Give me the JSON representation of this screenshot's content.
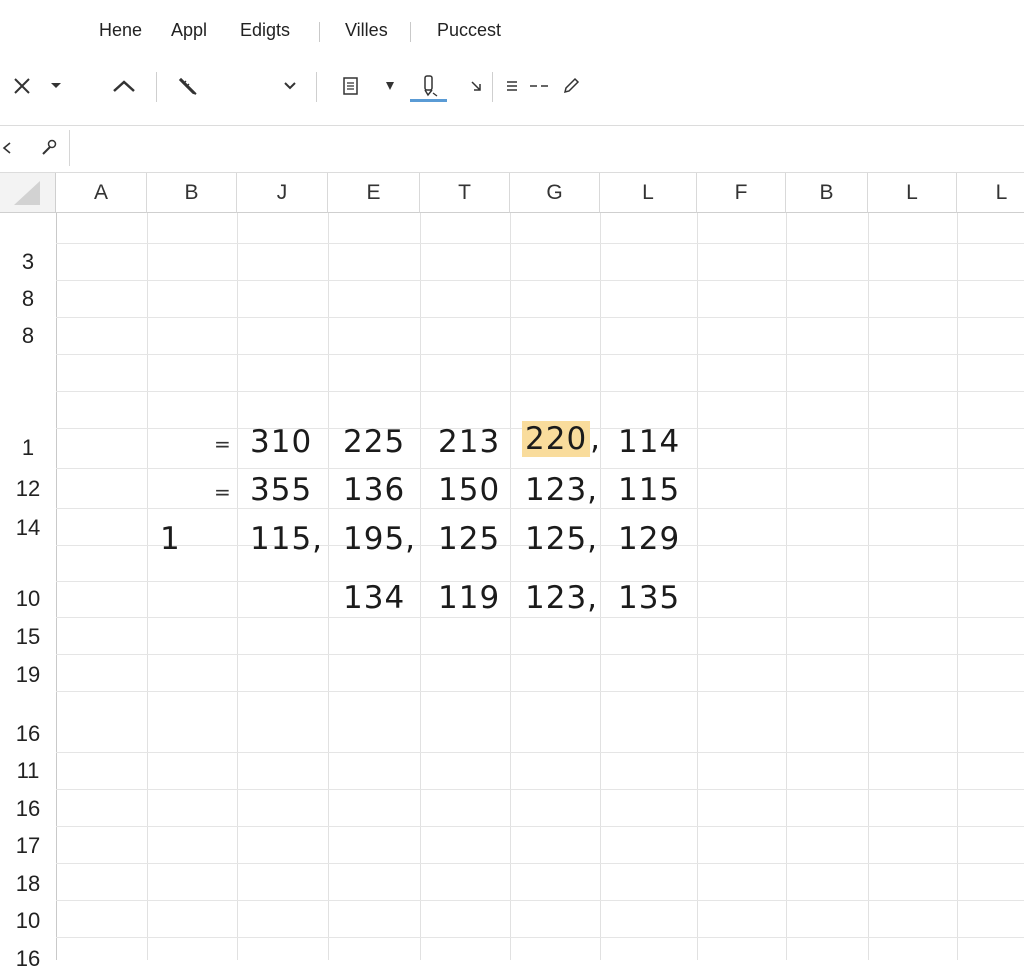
{
  "menu": {
    "items": [
      "Hene",
      "Appl",
      "Edigts",
      "Villes",
      "Puccest"
    ]
  },
  "toolbar": {
    "icons": [
      "close-icon",
      "chevron-down-icon",
      "chevron-up-icon",
      "pencil-ruler-icon",
      "chevron-down-icon",
      "clipboard-icon",
      "caret-down-icon",
      "highlighter-icon",
      "caret-down-icon",
      "list-icon",
      "dash-icon",
      "pen-icon"
    ]
  },
  "formula_bar": {
    "value": "",
    "icons": [
      "cancel-icon",
      "wrench-icon"
    ]
  },
  "grid": {
    "columns": [
      "A",
      "B",
      "J",
      "E",
      "T",
      "G",
      "L",
      "F",
      "B",
      "L",
      "L"
    ],
    "rows": [
      "3",
      "8",
      "8",
      "",
      "",
      "1",
      "12",
      "14",
      "",
      "10",
      "15",
      "19",
      "",
      "16",
      "11",
      "16",
      "17",
      "18",
      "10",
      "16"
    ],
    "data_rows": [
      {
        "b": "",
        "b_eq": "=",
        "j": "310",
        "e": "225",
        "t": "213",
        "g": "220",
        "g_suffix": ",",
        "l": "114"
      },
      {
        "b": "",
        "b_eq": "=",
        "j": "355",
        "e": "136",
        "t": "150",
        "g": "123,",
        "g_suffix": "",
        "l": "115"
      },
      {
        "b": "1",
        "b_eq": "",
        "j": "115,",
        "e": "195,",
        "t": "125",
        "g": "125,",
        "g_suffix": "",
        "l": "129"
      },
      {
        "b": "",
        "b_eq": "",
        "j": "",
        "e": "134",
        "t": "119",
        "g": "123,",
        "g_suffix": "",
        "l": "135"
      }
    ],
    "highlight_color": "#f9dc9c"
  }
}
